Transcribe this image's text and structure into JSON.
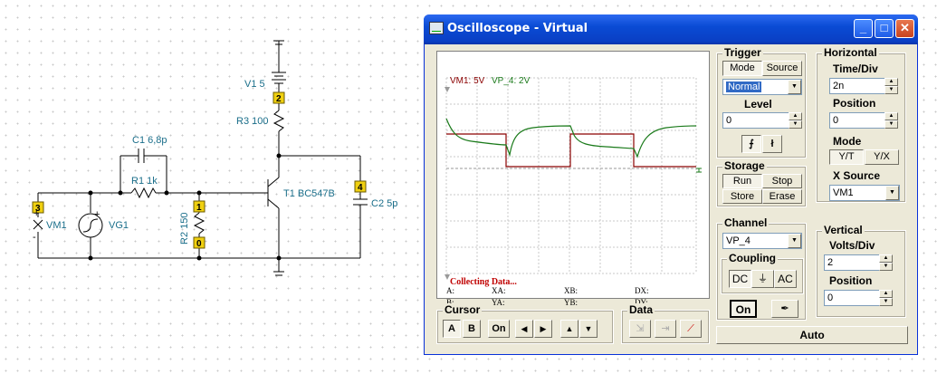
{
  "schematic": {
    "node_labels": [
      "3",
      "2",
      "1",
      "0",
      "4"
    ],
    "v1_label": "V1 5",
    "r3_label": "R3 100",
    "c1_label": "C1 6,8p",
    "r1_label": "R1 1k",
    "r2_label": "R2 150",
    "t1_label": "T1 BC547B",
    "c2_label": "C2 5p",
    "vm1_label": "VM1",
    "vg1_label": "VG1",
    "plus": "+",
    "minus": "-"
  },
  "window": {
    "title": "Oscilloscope - Virtual",
    "minimize": "_",
    "maximize": "□",
    "close": "✕"
  },
  "screen": {
    "ch1_label": "VM1: 5V",
    "ch2_label": "VP_4: 2V",
    "status": "Collecting Data...",
    "readouts": [
      "A:",
      "XA:",
      "XB:",
      "DX:",
      "B:",
      "YA:",
      "YB:",
      "DY:"
    ]
  },
  "trigger": {
    "title": "Trigger",
    "mode_btn": "Mode",
    "source_btn": "Source",
    "mode_value": "Normal",
    "level_label": "Level",
    "level_value": "0"
  },
  "storage": {
    "title": "Storage",
    "run": "Run",
    "stop": "Stop",
    "store": "Store",
    "erase": "Erase"
  },
  "horizontal": {
    "title": "Horizontal",
    "timediv_label": "Time/Div",
    "timediv_value": "2n",
    "position_label": "Position",
    "position_value": "0",
    "mode_label": "Mode",
    "yt": "Y/T",
    "yx": "Y/X",
    "xsource_label": "X Source",
    "xsource_value": "VM1"
  },
  "channel": {
    "title": "Channel",
    "value": "VP_4",
    "coupling_title": "Coupling",
    "dc": "DC",
    "gnd": "⏚",
    "ac": "AC",
    "on": "On"
  },
  "vertical": {
    "title": "Vertical",
    "voltsdiv_label": "Volts/Div",
    "voltsdiv_value": "2",
    "position_label": "Position",
    "position_value": "0"
  },
  "cursor": {
    "title": "Cursor",
    "a": "A",
    "b": "B",
    "on": "On",
    "left": "◀",
    "right": "▶",
    "up": "▲",
    "down": "▼"
  },
  "data_group": {
    "title": "Data"
  },
  "auto": "Auto",
  "colors": {
    "ch1": "#8b0000",
    "ch2": "#1a7a1a",
    "title_bar": "#0a4bd4",
    "status": "#c00000"
  }
}
